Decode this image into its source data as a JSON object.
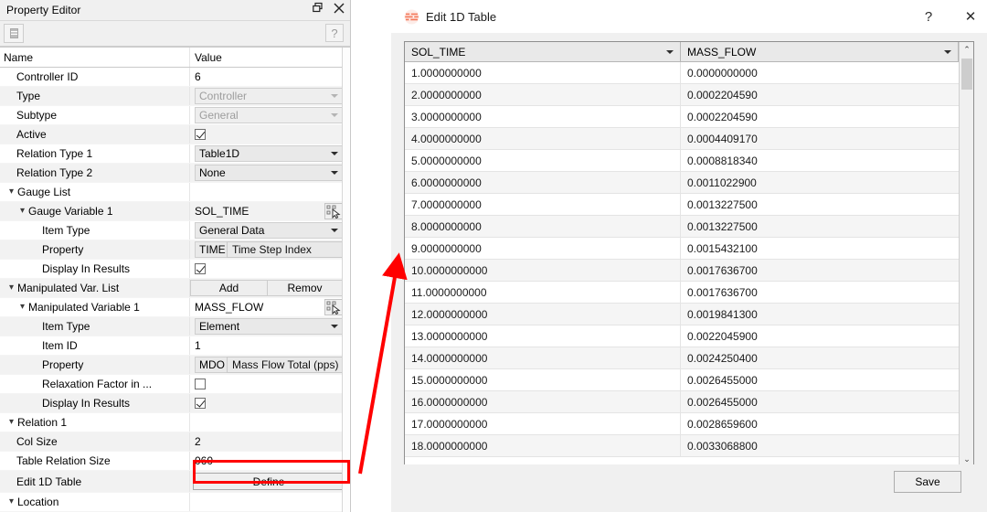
{
  "property_editor": {
    "title": "Property Editor",
    "titlebar_icons": [
      "float-icon",
      "close-icon"
    ],
    "toolbar": {
      "sort_button_icon": "sort-icon",
      "help_label": "?"
    },
    "columns": {
      "name": "Name",
      "value": "Value"
    },
    "rows": [
      {
        "name": "Controller ID",
        "indent": 1,
        "type": "text",
        "value": "6"
      },
      {
        "name": "Type",
        "indent": 1,
        "type": "combo",
        "value": "Controller",
        "disabled": true
      },
      {
        "name": "Subtype",
        "indent": 1,
        "type": "combo",
        "value": "General",
        "disabled": true
      },
      {
        "name": "Active",
        "indent": 1,
        "type": "checkbox",
        "checked": true
      },
      {
        "name": "Relation Type 1",
        "indent": 1,
        "type": "combo",
        "value": "Table1D",
        "disabled": false
      },
      {
        "name": "Relation Type 2",
        "indent": 1,
        "type": "combo",
        "value": "None",
        "disabled": false
      },
      {
        "name": "Gauge List",
        "indent": 0,
        "type": "group",
        "expander": "v"
      },
      {
        "name": "Gauge Variable 1",
        "indent": 1,
        "type": "picker",
        "expander": "v",
        "value": "SOL_TIME"
      },
      {
        "name": "Item Type",
        "indent": 2,
        "type": "combo",
        "value": "General Data",
        "disabled": false
      },
      {
        "name": "Property",
        "indent": 2,
        "type": "combo-tooltip",
        "value": "TIME",
        "tooltip": "Time Step Index"
      },
      {
        "name": "Display In Results",
        "indent": 2,
        "type": "checkbox",
        "checked": true
      },
      {
        "name": "Manipulated Var. List",
        "indent": 0,
        "type": "addremove",
        "expander": "v",
        "add_label": "Add",
        "remove_label": "Remov"
      },
      {
        "name": "Manipulated Variable 1",
        "indent": 1,
        "type": "picker",
        "expander": "v",
        "value": "MASS_FLOW"
      },
      {
        "name": "Item Type",
        "indent": 2,
        "type": "combo",
        "value": "Element",
        "disabled": false
      },
      {
        "name": "Item ID",
        "indent": 2,
        "type": "text",
        "value": "1"
      },
      {
        "name": "Property",
        "indent": 2,
        "type": "combo-tooltip",
        "value": "MDO",
        "tooltip": "Mass Flow Total (pps)"
      },
      {
        "name": "Relaxation Factor in ...",
        "indent": 2,
        "type": "checkbox",
        "checked": false
      },
      {
        "name": "Display In Results",
        "indent": 2,
        "type": "checkbox",
        "checked": true
      },
      {
        "name": "Relation 1",
        "indent": 0,
        "type": "group",
        "expander": "v"
      },
      {
        "name": "Col Size",
        "indent": 1,
        "type": "text",
        "value": "2"
      },
      {
        "name": "Table Relation Size",
        "indent": 1,
        "type": "text",
        "value": "060"
      },
      {
        "name": "Edit 1D Table",
        "indent": 1,
        "type": "button",
        "value": "Define"
      },
      {
        "name": "Location",
        "indent": 0,
        "type": "group",
        "expander": "v"
      }
    ]
  },
  "annotation": {
    "highlight_color": "#ff0000",
    "arrow_color": "#ff0000"
  },
  "dialog": {
    "title": "Edit 1D Table",
    "logo_icon": "ansys-logo-icon",
    "help_label": "?",
    "close_label": "✕",
    "save_label": "Save",
    "scrollbar": {
      "up_label": "⌃",
      "down_label": "⌄"
    },
    "table": {
      "columns": [
        "SOL_TIME",
        "MASS_FLOW"
      ],
      "rows": [
        [
          "1.0000000000",
          "0.0000000000"
        ],
        [
          "2.0000000000",
          "0.0002204590"
        ],
        [
          "3.0000000000",
          "0.0002204590"
        ],
        [
          "4.0000000000",
          "0.0004409170"
        ],
        [
          "5.0000000000",
          "0.0008818340"
        ],
        [
          "6.0000000000",
          "0.0011022900"
        ],
        [
          "7.0000000000",
          "0.0013227500"
        ],
        [
          "8.0000000000",
          "0.0013227500"
        ],
        [
          "9.0000000000",
          "0.0015432100"
        ],
        [
          "10.0000000000",
          "0.0017636700"
        ],
        [
          "11.0000000000",
          "0.0017636700"
        ],
        [
          "12.0000000000",
          "0.0019841300"
        ],
        [
          "13.0000000000",
          "0.0022045900"
        ],
        [
          "14.0000000000",
          "0.0024250400"
        ],
        [
          "15.0000000000",
          "0.0026455000"
        ],
        [
          "16.0000000000",
          "0.0026455000"
        ],
        [
          "17.0000000000",
          "0.0028659600"
        ],
        [
          "18.0000000000",
          "0.0033068800"
        ]
      ]
    }
  }
}
